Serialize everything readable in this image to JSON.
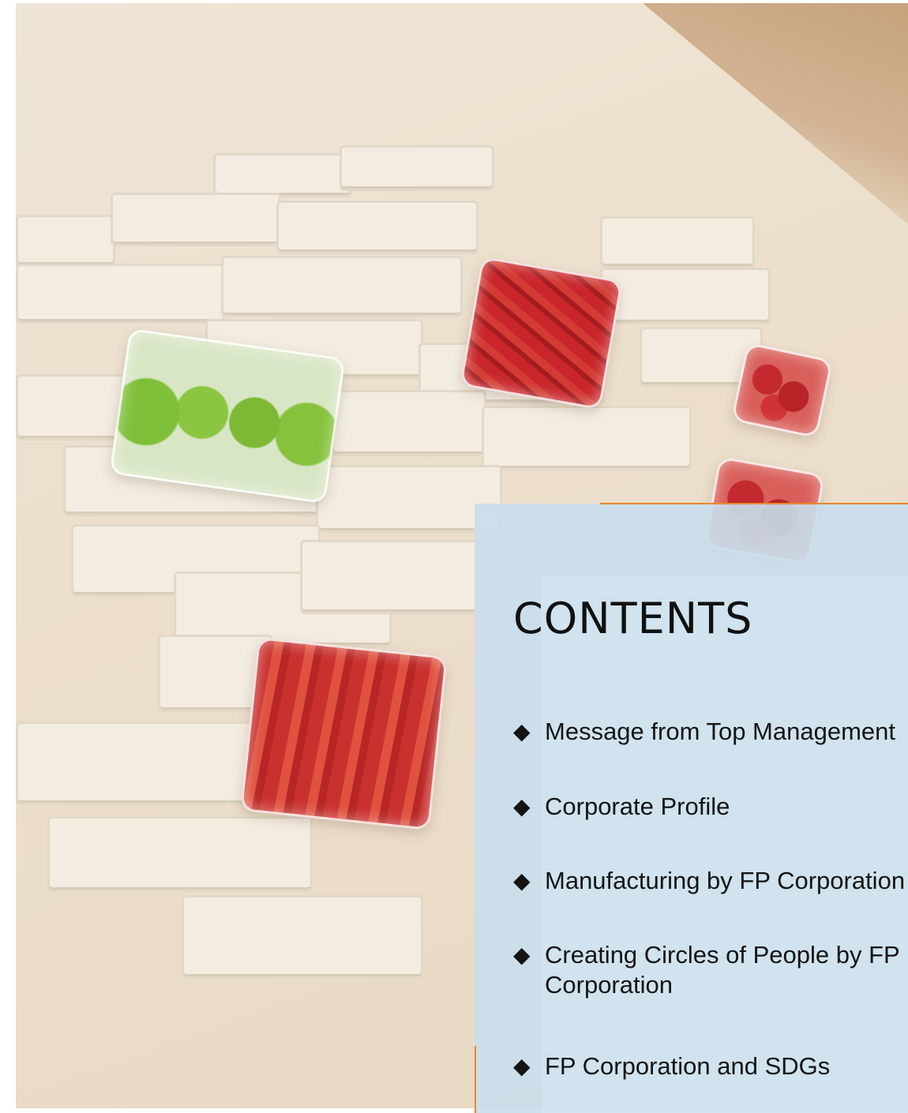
{
  "contents": {
    "title": "CONTENTS",
    "bullet_glyph": "◆",
    "items": [
      {
        "label": "Message from Top Management"
      },
      {
        "label": "Corporate Profile"
      },
      {
        "label": "Manufacturing by FP Corporation"
      },
      {
        "label": "Creating Circles of People by FP Corporation"
      },
      {
        "label": "FP Corporation and SDGs"
      }
    ]
  },
  "colors": {
    "accent": "#e6892d",
    "panel": "#c8deec",
    "text": "#111111"
  }
}
